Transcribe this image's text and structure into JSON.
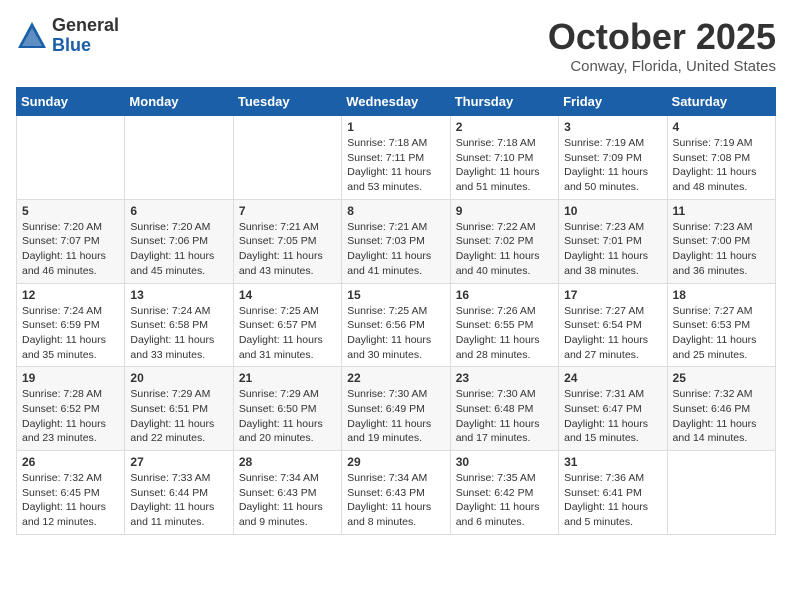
{
  "logo": {
    "general": "General",
    "blue": "Blue"
  },
  "title": "October 2025",
  "location": "Conway, Florida, United States",
  "days_of_week": [
    "Sunday",
    "Monday",
    "Tuesday",
    "Wednesday",
    "Thursday",
    "Friday",
    "Saturday"
  ],
  "weeks": [
    [
      {
        "day": "",
        "info": ""
      },
      {
        "day": "",
        "info": ""
      },
      {
        "day": "",
        "info": ""
      },
      {
        "day": "1",
        "info": "Sunrise: 7:18 AM\nSunset: 7:11 PM\nDaylight: 11 hours\nand 53 minutes."
      },
      {
        "day": "2",
        "info": "Sunrise: 7:18 AM\nSunset: 7:10 PM\nDaylight: 11 hours\nand 51 minutes."
      },
      {
        "day": "3",
        "info": "Sunrise: 7:19 AM\nSunset: 7:09 PM\nDaylight: 11 hours\nand 50 minutes."
      },
      {
        "day": "4",
        "info": "Sunrise: 7:19 AM\nSunset: 7:08 PM\nDaylight: 11 hours\nand 48 minutes."
      }
    ],
    [
      {
        "day": "5",
        "info": "Sunrise: 7:20 AM\nSunset: 7:07 PM\nDaylight: 11 hours\nand 46 minutes."
      },
      {
        "day": "6",
        "info": "Sunrise: 7:20 AM\nSunset: 7:06 PM\nDaylight: 11 hours\nand 45 minutes."
      },
      {
        "day": "7",
        "info": "Sunrise: 7:21 AM\nSunset: 7:05 PM\nDaylight: 11 hours\nand 43 minutes."
      },
      {
        "day": "8",
        "info": "Sunrise: 7:21 AM\nSunset: 7:03 PM\nDaylight: 11 hours\nand 41 minutes."
      },
      {
        "day": "9",
        "info": "Sunrise: 7:22 AM\nSunset: 7:02 PM\nDaylight: 11 hours\nand 40 minutes."
      },
      {
        "day": "10",
        "info": "Sunrise: 7:23 AM\nSunset: 7:01 PM\nDaylight: 11 hours\nand 38 minutes."
      },
      {
        "day": "11",
        "info": "Sunrise: 7:23 AM\nSunset: 7:00 PM\nDaylight: 11 hours\nand 36 minutes."
      }
    ],
    [
      {
        "day": "12",
        "info": "Sunrise: 7:24 AM\nSunset: 6:59 PM\nDaylight: 11 hours\nand 35 minutes."
      },
      {
        "day": "13",
        "info": "Sunrise: 7:24 AM\nSunset: 6:58 PM\nDaylight: 11 hours\nand 33 minutes."
      },
      {
        "day": "14",
        "info": "Sunrise: 7:25 AM\nSunset: 6:57 PM\nDaylight: 11 hours\nand 31 minutes."
      },
      {
        "day": "15",
        "info": "Sunrise: 7:25 AM\nSunset: 6:56 PM\nDaylight: 11 hours\nand 30 minutes."
      },
      {
        "day": "16",
        "info": "Sunrise: 7:26 AM\nSunset: 6:55 PM\nDaylight: 11 hours\nand 28 minutes."
      },
      {
        "day": "17",
        "info": "Sunrise: 7:27 AM\nSunset: 6:54 PM\nDaylight: 11 hours\nand 27 minutes."
      },
      {
        "day": "18",
        "info": "Sunrise: 7:27 AM\nSunset: 6:53 PM\nDaylight: 11 hours\nand 25 minutes."
      }
    ],
    [
      {
        "day": "19",
        "info": "Sunrise: 7:28 AM\nSunset: 6:52 PM\nDaylight: 11 hours\nand 23 minutes."
      },
      {
        "day": "20",
        "info": "Sunrise: 7:29 AM\nSunset: 6:51 PM\nDaylight: 11 hours\nand 22 minutes."
      },
      {
        "day": "21",
        "info": "Sunrise: 7:29 AM\nSunset: 6:50 PM\nDaylight: 11 hours\nand 20 minutes."
      },
      {
        "day": "22",
        "info": "Sunrise: 7:30 AM\nSunset: 6:49 PM\nDaylight: 11 hours\nand 19 minutes."
      },
      {
        "day": "23",
        "info": "Sunrise: 7:30 AM\nSunset: 6:48 PM\nDaylight: 11 hours\nand 17 minutes."
      },
      {
        "day": "24",
        "info": "Sunrise: 7:31 AM\nSunset: 6:47 PM\nDaylight: 11 hours\nand 15 minutes."
      },
      {
        "day": "25",
        "info": "Sunrise: 7:32 AM\nSunset: 6:46 PM\nDaylight: 11 hours\nand 14 minutes."
      }
    ],
    [
      {
        "day": "26",
        "info": "Sunrise: 7:32 AM\nSunset: 6:45 PM\nDaylight: 11 hours\nand 12 minutes."
      },
      {
        "day": "27",
        "info": "Sunrise: 7:33 AM\nSunset: 6:44 PM\nDaylight: 11 hours\nand 11 minutes."
      },
      {
        "day": "28",
        "info": "Sunrise: 7:34 AM\nSunset: 6:43 PM\nDaylight: 11 hours\nand 9 minutes."
      },
      {
        "day": "29",
        "info": "Sunrise: 7:34 AM\nSunset: 6:43 PM\nDaylight: 11 hours\nand 8 minutes."
      },
      {
        "day": "30",
        "info": "Sunrise: 7:35 AM\nSunset: 6:42 PM\nDaylight: 11 hours\nand 6 minutes."
      },
      {
        "day": "31",
        "info": "Sunrise: 7:36 AM\nSunset: 6:41 PM\nDaylight: 11 hours\nand 5 minutes."
      },
      {
        "day": "",
        "info": ""
      }
    ]
  ]
}
